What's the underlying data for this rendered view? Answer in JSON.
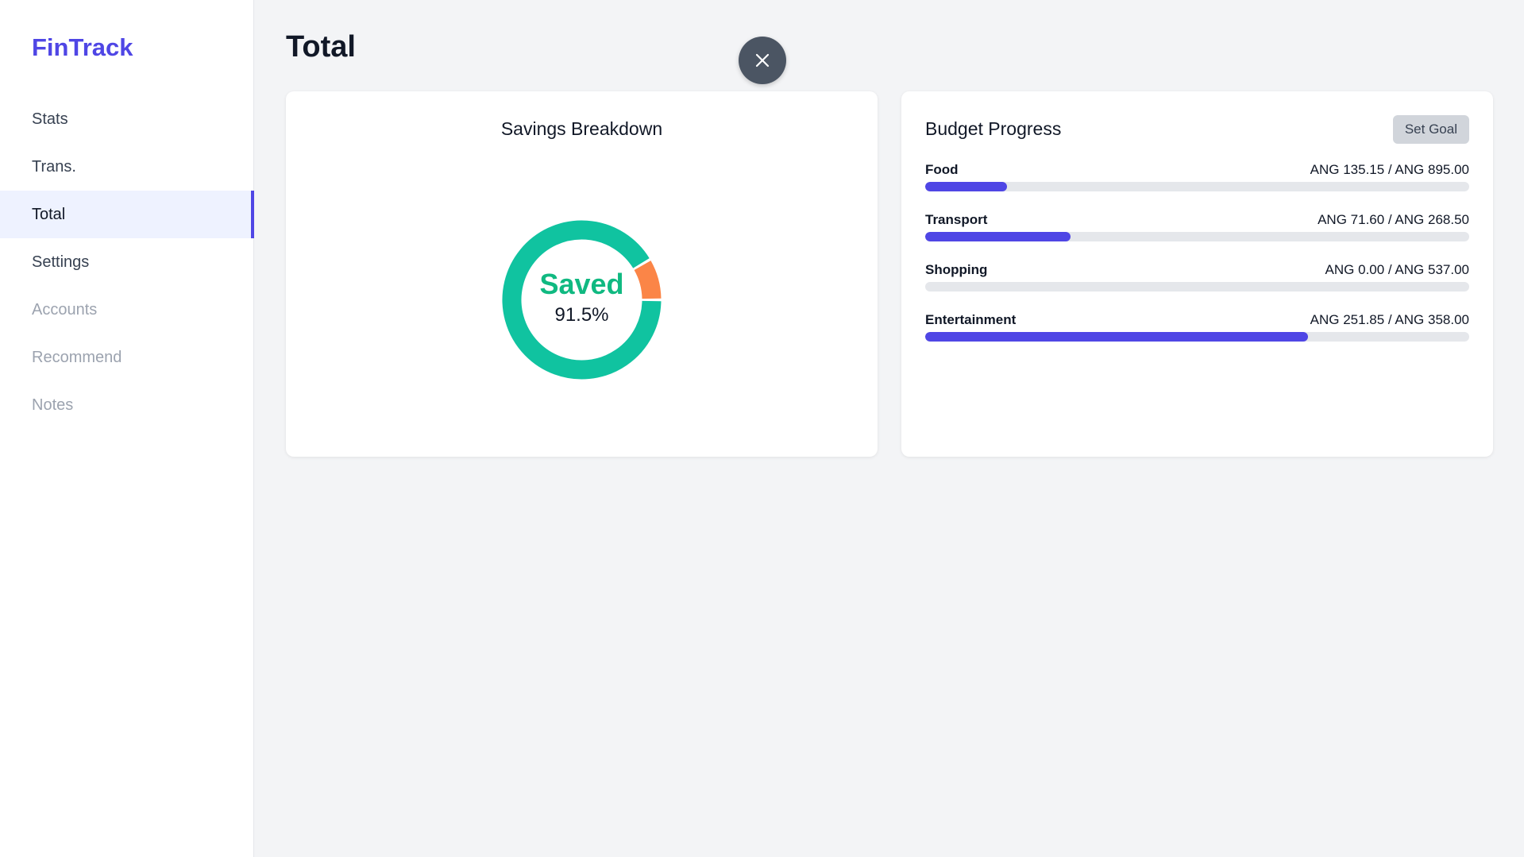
{
  "brand": "FinTrack",
  "sidebar": {
    "items": [
      {
        "label": "Stats",
        "state": "normal"
      },
      {
        "label": "Trans.",
        "state": "normal"
      },
      {
        "label": "Total",
        "state": "active"
      },
      {
        "label": "Settings",
        "state": "normal"
      },
      {
        "label": "Accounts",
        "state": "muted"
      },
      {
        "label": "Recommend",
        "state": "muted"
      },
      {
        "label": "Notes",
        "state": "muted"
      }
    ]
  },
  "page": {
    "title": "Total"
  },
  "close_button": {
    "icon": "close-icon"
  },
  "savings": {
    "title": "Savings Breakdown",
    "center_label": "Saved",
    "center_value": "91.5%",
    "saved_fraction": 0.915,
    "colors": {
      "saved": "#10c3a0",
      "spent": "#fb8547"
    }
  },
  "budget": {
    "title": "Budget Progress",
    "set_goal_label": "Set Goal",
    "items": [
      {
        "name": "Food",
        "amount_text": "ANG 135.15 / ANG 895.00",
        "spent": 135.15,
        "limit": 895.0
      },
      {
        "name": "Transport",
        "amount_text": "ANG 71.60 / ANG 268.50",
        "spent": 71.6,
        "limit": 268.5
      },
      {
        "name": "Shopping",
        "amount_text": "ANG 0.00 / ANG 537.00",
        "spent": 0.0,
        "limit": 537.0
      },
      {
        "name": "Entertainment",
        "amount_text": "ANG 251.85 / ANG 358.00",
        "spent": 251.85,
        "limit": 358.0
      }
    ]
  },
  "colors": {
    "accent": "#4f46e5",
    "track": "#e5e7eb"
  }
}
